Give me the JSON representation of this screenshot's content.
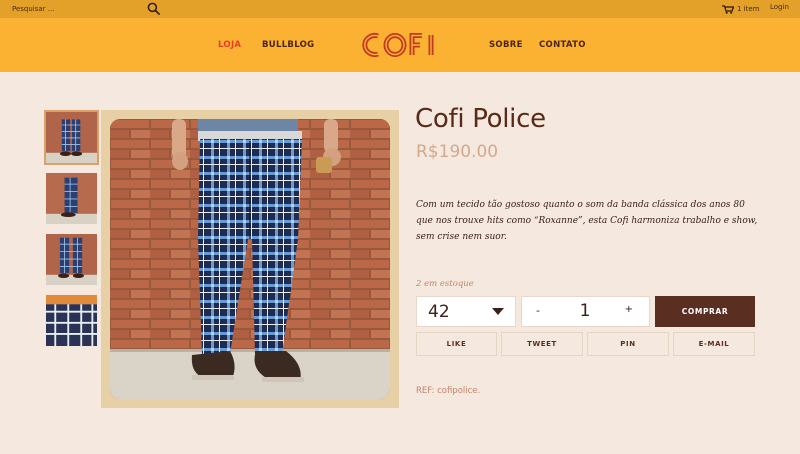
{
  "topbar": {
    "search_placeholder": "Pesquisar ...",
    "search_icon": "search-icon",
    "cart_label": "1 item",
    "cart_icon": "cart-icon",
    "login_label": "Login"
  },
  "header": {
    "nav_left": [
      "LOJA",
      "BULLBLOG"
    ],
    "logo_text": "COFI",
    "nav_right": [
      "SOBRE",
      "CONTATO"
    ],
    "active_nav": "LOJA"
  },
  "gallery": {
    "thumbnail_count": 4,
    "selected_index": 0
  },
  "product": {
    "title": "Cofi Police",
    "price": "R$190.00",
    "description": "Com um tecido tão gostoso quanto o som da banda clássica dos anos 80 que nos trouxe hits como “Roxanne”, esta Cofi harmoniza trabalho e show, sem crise nem suor.",
    "stock": "2 em estoque",
    "size_selected": "42",
    "quantity_minus": "-",
    "quantity": "1",
    "quantity_plus": "+",
    "buy_label": "COMPRAR",
    "share": [
      "LIKE",
      "TWEET",
      "PIN",
      "E-MAIL"
    ],
    "ref": "REF: cofipolice."
  },
  "colors": {
    "topbar": "#e4a12a",
    "header": "#fbb233",
    "page_bg": "#f4e8df",
    "brand_dark": "#5a2f22",
    "accent_red": "#e0402a",
    "price": "#d3a98e"
  }
}
